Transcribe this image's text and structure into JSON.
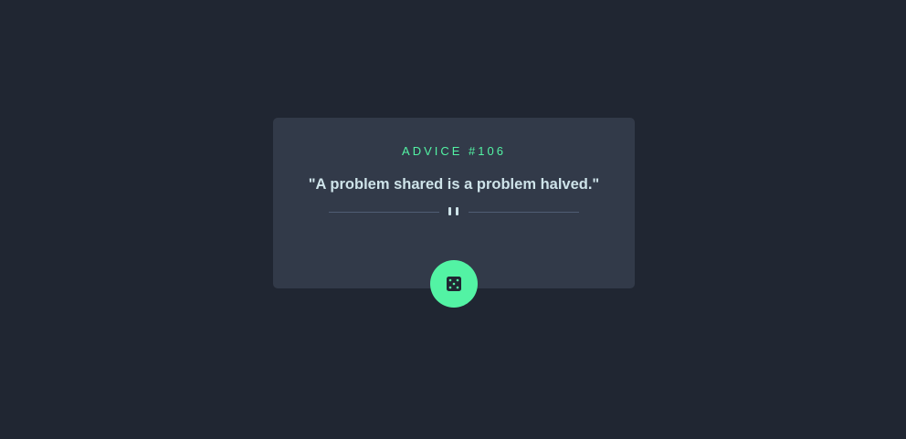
{
  "advice": {
    "id_label": "ADVICE #106",
    "quote": "\"A problem shared is a problem halved.\""
  },
  "divider": {
    "icon": "pause-divider-icon"
  },
  "button": {
    "icon": "dice-icon"
  },
  "colors": {
    "background": "#202632",
    "card": "#323A49",
    "accent": "#53F3A4",
    "text": "#CEE3E9",
    "divider_line": "#4F5D74"
  }
}
